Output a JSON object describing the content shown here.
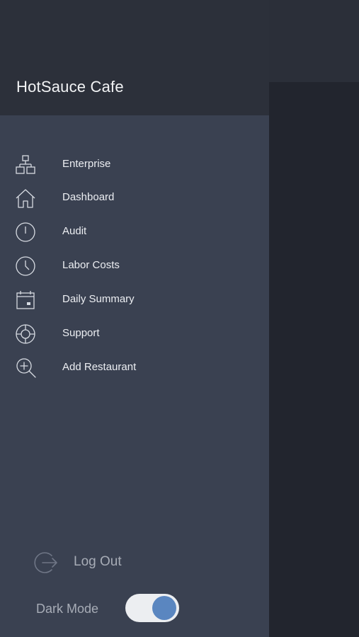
{
  "app": {
    "title": "HotSauce Cafe"
  },
  "menu": {
    "items": [
      {
        "label": "Enterprise",
        "icon": "sitemap-icon"
      },
      {
        "label": "Dashboard",
        "icon": "home-icon"
      },
      {
        "label": "Audit",
        "icon": "alert-circle-icon"
      },
      {
        "label": "Labor Costs",
        "icon": "clock-icon"
      },
      {
        "label": "Daily Summary",
        "icon": "calendar-icon"
      },
      {
        "label": "Support",
        "icon": "lifebuoy-icon"
      },
      {
        "label": "Add Restaurant",
        "icon": "zoom-in-icon"
      }
    ]
  },
  "footer": {
    "logout_label": "Log Out",
    "dark_mode_label": "Dark Mode",
    "dark_mode_on": true
  },
  "colors": {
    "drawer_bg": "#3a4151",
    "header_bg": "#2c303a",
    "icon_stroke": "#d7dbe2",
    "toggle_knob": "#5a86c0"
  }
}
